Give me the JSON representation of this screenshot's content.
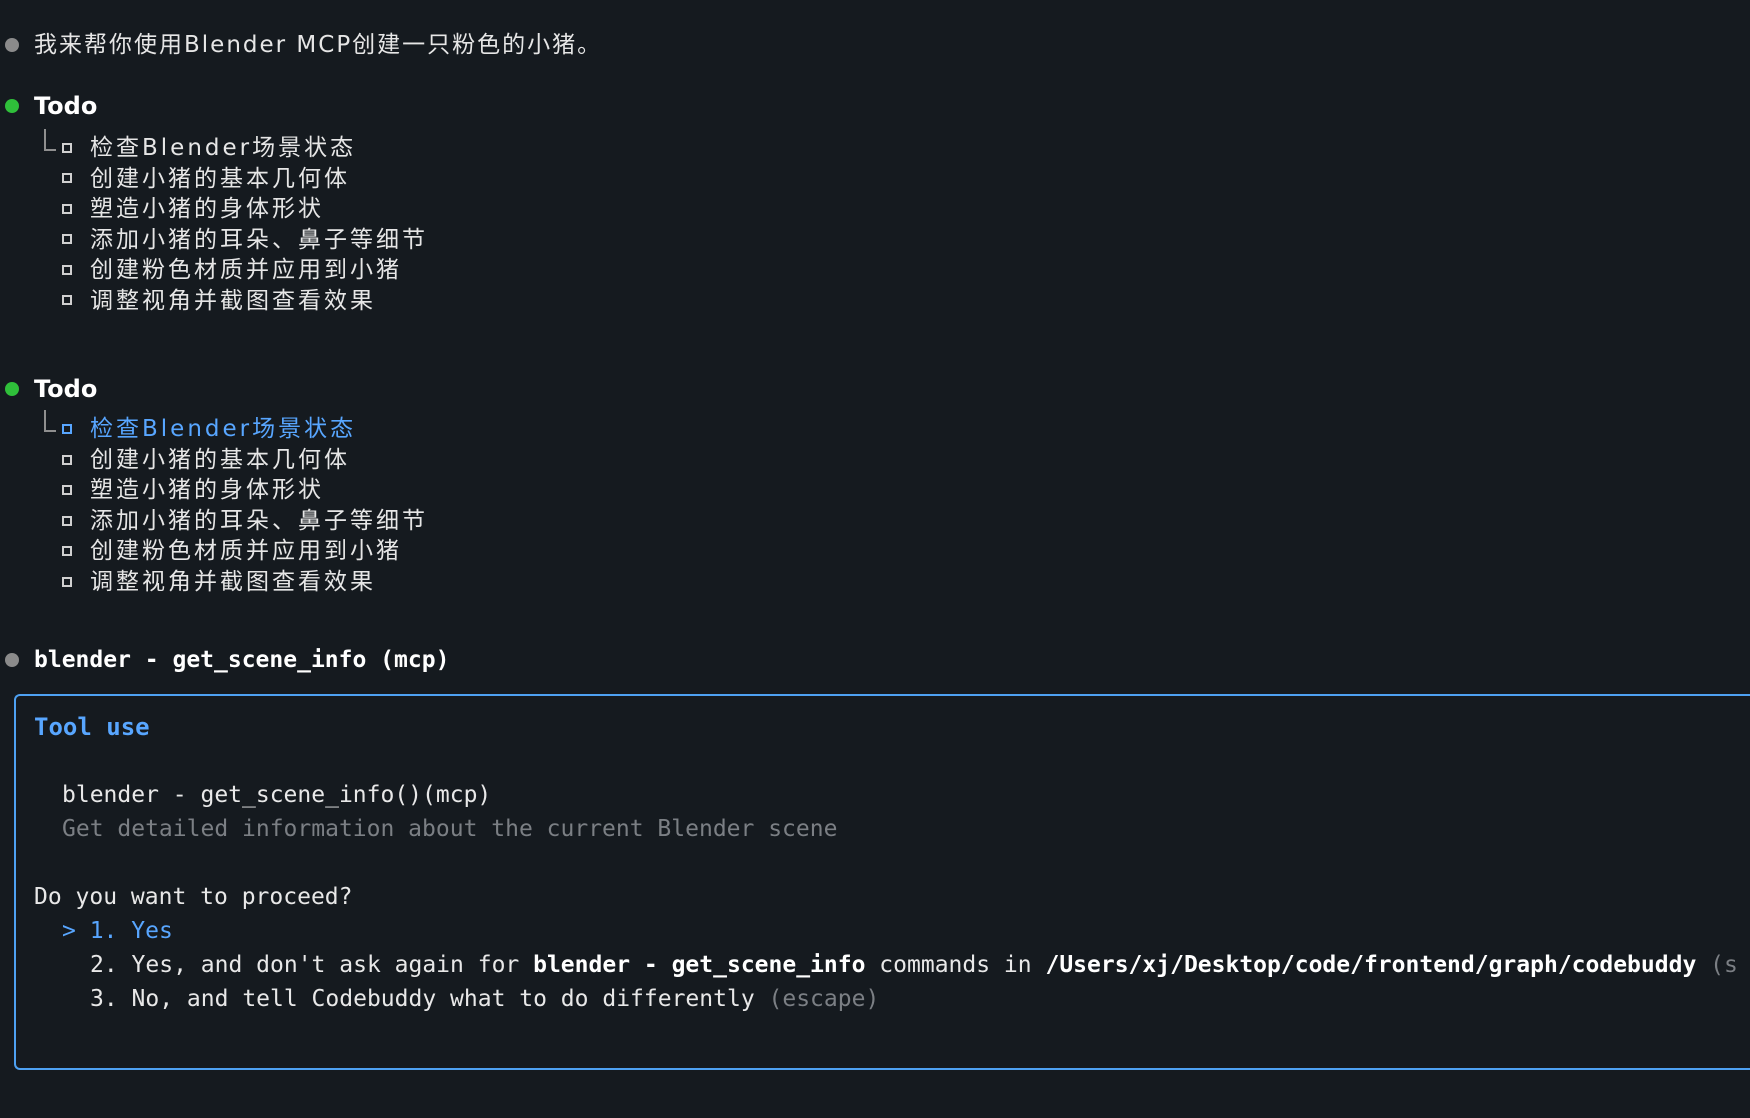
{
  "intro": {
    "text": "我来帮你使用Blender MCP创建一只粉色的小猪。"
  },
  "todo1": {
    "heading": "Todo",
    "items": [
      "检查Blender场景状态",
      "创建小猪的基本几何体",
      "塑造小猪的身体形状",
      "添加小猪的耳朵、鼻子等细节",
      "创建粉色材质并应用到小猪",
      "调整视角并截图查看效果"
    ]
  },
  "todo2": {
    "heading": "Todo",
    "items": [
      "检查Blender场景状态",
      "创建小猪的基本几何体",
      "塑造小猪的身体形状",
      "添加小猪的耳朵、鼻子等细节",
      "创建粉色材质并应用到小猪",
      "调整视角并截图查看效果"
    ]
  },
  "tool_call": {
    "title": "blender - get_scene_info (mcp)"
  },
  "tool_use": {
    "title": "Tool use",
    "command": "blender - get_scene_info()(mcp)",
    "description": "Get detailed information about the current Blender scene",
    "question": "Do you want to proceed?",
    "options": {
      "opt1": {
        "prefix": "> 1. ",
        "label": "Yes"
      },
      "opt2": {
        "prefix": "2. Yes, and don't ask again for ",
        "command": "blender - get_scene_info",
        "middle": " commands in ",
        "path": "/Users/xj/Desktop/code/frontend/graph/codebuddy",
        "suffix": " (s"
      },
      "opt3": {
        "label": "3. No, and tell Codebuddy what to do differently",
        "hint": " (escape)"
      }
    }
  },
  "colors": {
    "background": "#151a1f",
    "accent_blue": "#58a6ff",
    "border_blue": "#4ea1f2",
    "status_green": "#2fbf3a",
    "dot_gray": "#8b8b8b",
    "muted_text": "#7b7f84"
  }
}
